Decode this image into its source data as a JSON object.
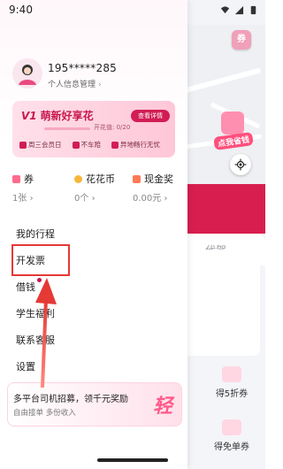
{
  "status_bar": {
    "time": "9:40"
  },
  "profile": {
    "phone_masked": "195*****285",
    "manage_label": "个人信息管理",
    "manage_chevron": "›"
  },
  "vip": {
    "level": "V1",
    "title": "萌新好享花",
    "details_button": "查看详情",
    "progress_label": "开花值: 0/20",
    "progress_fraction": 0,
    "perks": [
      "周三会员日",
      "不车赔",
      "异地畅行无忧"
    ]
  },
  "stats": [
    {
      "label": "券",
      "value": "1张",
      "chevron": "›",
      "color": "#ff6b8b"
    },
    {
      "label": "花花币",
      "value": "0个",
      "chevron": "›",
      "color": "#f6b73c"
    },
    {
      "label": "现金奖",
      "value": "0.00元",
      "chevron": "›",
      "color": "#ff7a55"
    }
  ],
  "menu": [
    {
      "label": "我的行程"
    },
    {
      "label": "开发票"
    },
    {
      "label": "借钱"
    },
    {
      "label": "学生福利"
    },
    {
      "label": "联系客服"
    },
    {
      "label": "设置"
    }
  ],
  "recruit": {
    "title": "多平台司机招募，领千元奖励",
    "subtitle": "自由接单 多份收入",
    "logo_char": "轻"
  },
  "background": {
    "tab_label": "代驾",
    "promo_tag": "点我省钱",
    "items": [
      {
        "label": "得5折券"
      },
      {
        "label": "得免单券"
      }
    ],
    "accent": "#d81e4f"
  },
  "colors": {
    "brand": "#d11d54",
    "highlight": "#e53935"
  },
  "icons": {
    "wifi": "wifi-icon",
    "signal": "signal-icon",
    "battery": "battery-icon",
    "location": "locate-icon"
  }
}
